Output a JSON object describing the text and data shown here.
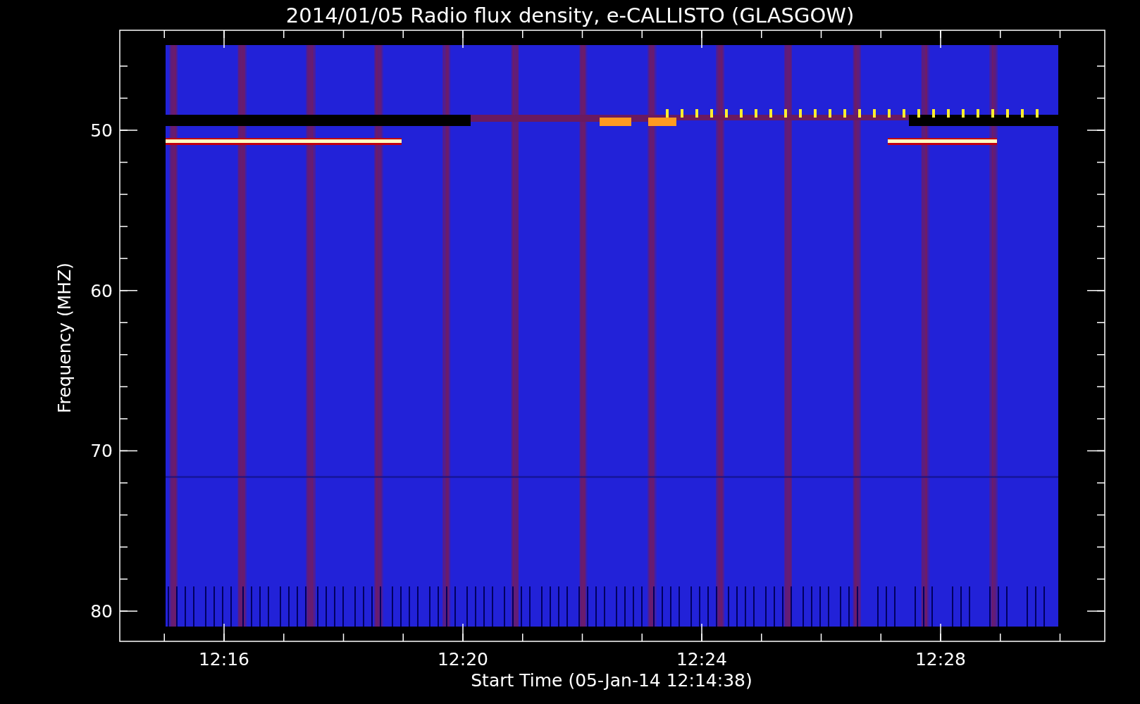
{
  "title": "2014/01/05  Radio flux density, e-CALLISTO (GLASGOW)",
  "y_axis": {
    "label": "Frequency (MHZ)",
    "ticks": [
      "50",
      "60",
      "70",
      "80"
    ]
  },
  "x_axis": {
    "label": "Start Time (05-Jan-14 12:14:38)",
    "ticks": [
      "12:16",
      "12:20",
      "12:24",
      "12:28"
    ]
  }
}
